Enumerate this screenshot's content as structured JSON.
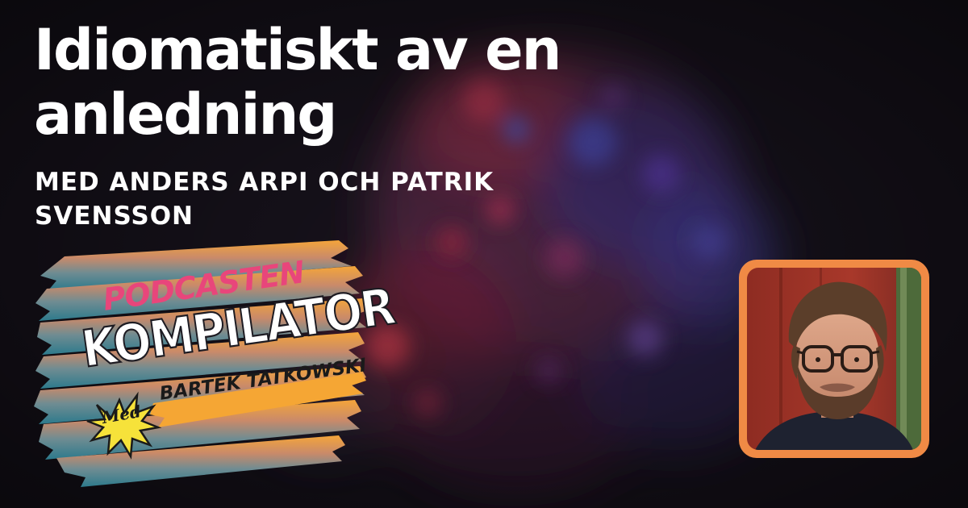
{
  "title": {
    "line1": "Idiomatiskt av en",
    "line2": "anledning"
  },
  "subtitle": {
    "line1": "MED ANDERS ARPI OCH PATRIK",
    "line2": "SVENSSON"
  },
  "logo": {
    "podcasten": "PODCASTEN",
    "kompilator": "KOMPILATOR",
    "med": "Med",
    "host": "BARTEK TATKOWSKI"
  },
  "photo": {
    "subject": "host-portrait"
  },
  "colors": {
    "background": "#17121c",
    "title_text": "#ffffff",
    "photo_frame": "#f08a45",
    "logo_pink": "#e8467b",
    "logo_banner": "#f5a634"
  }
}
